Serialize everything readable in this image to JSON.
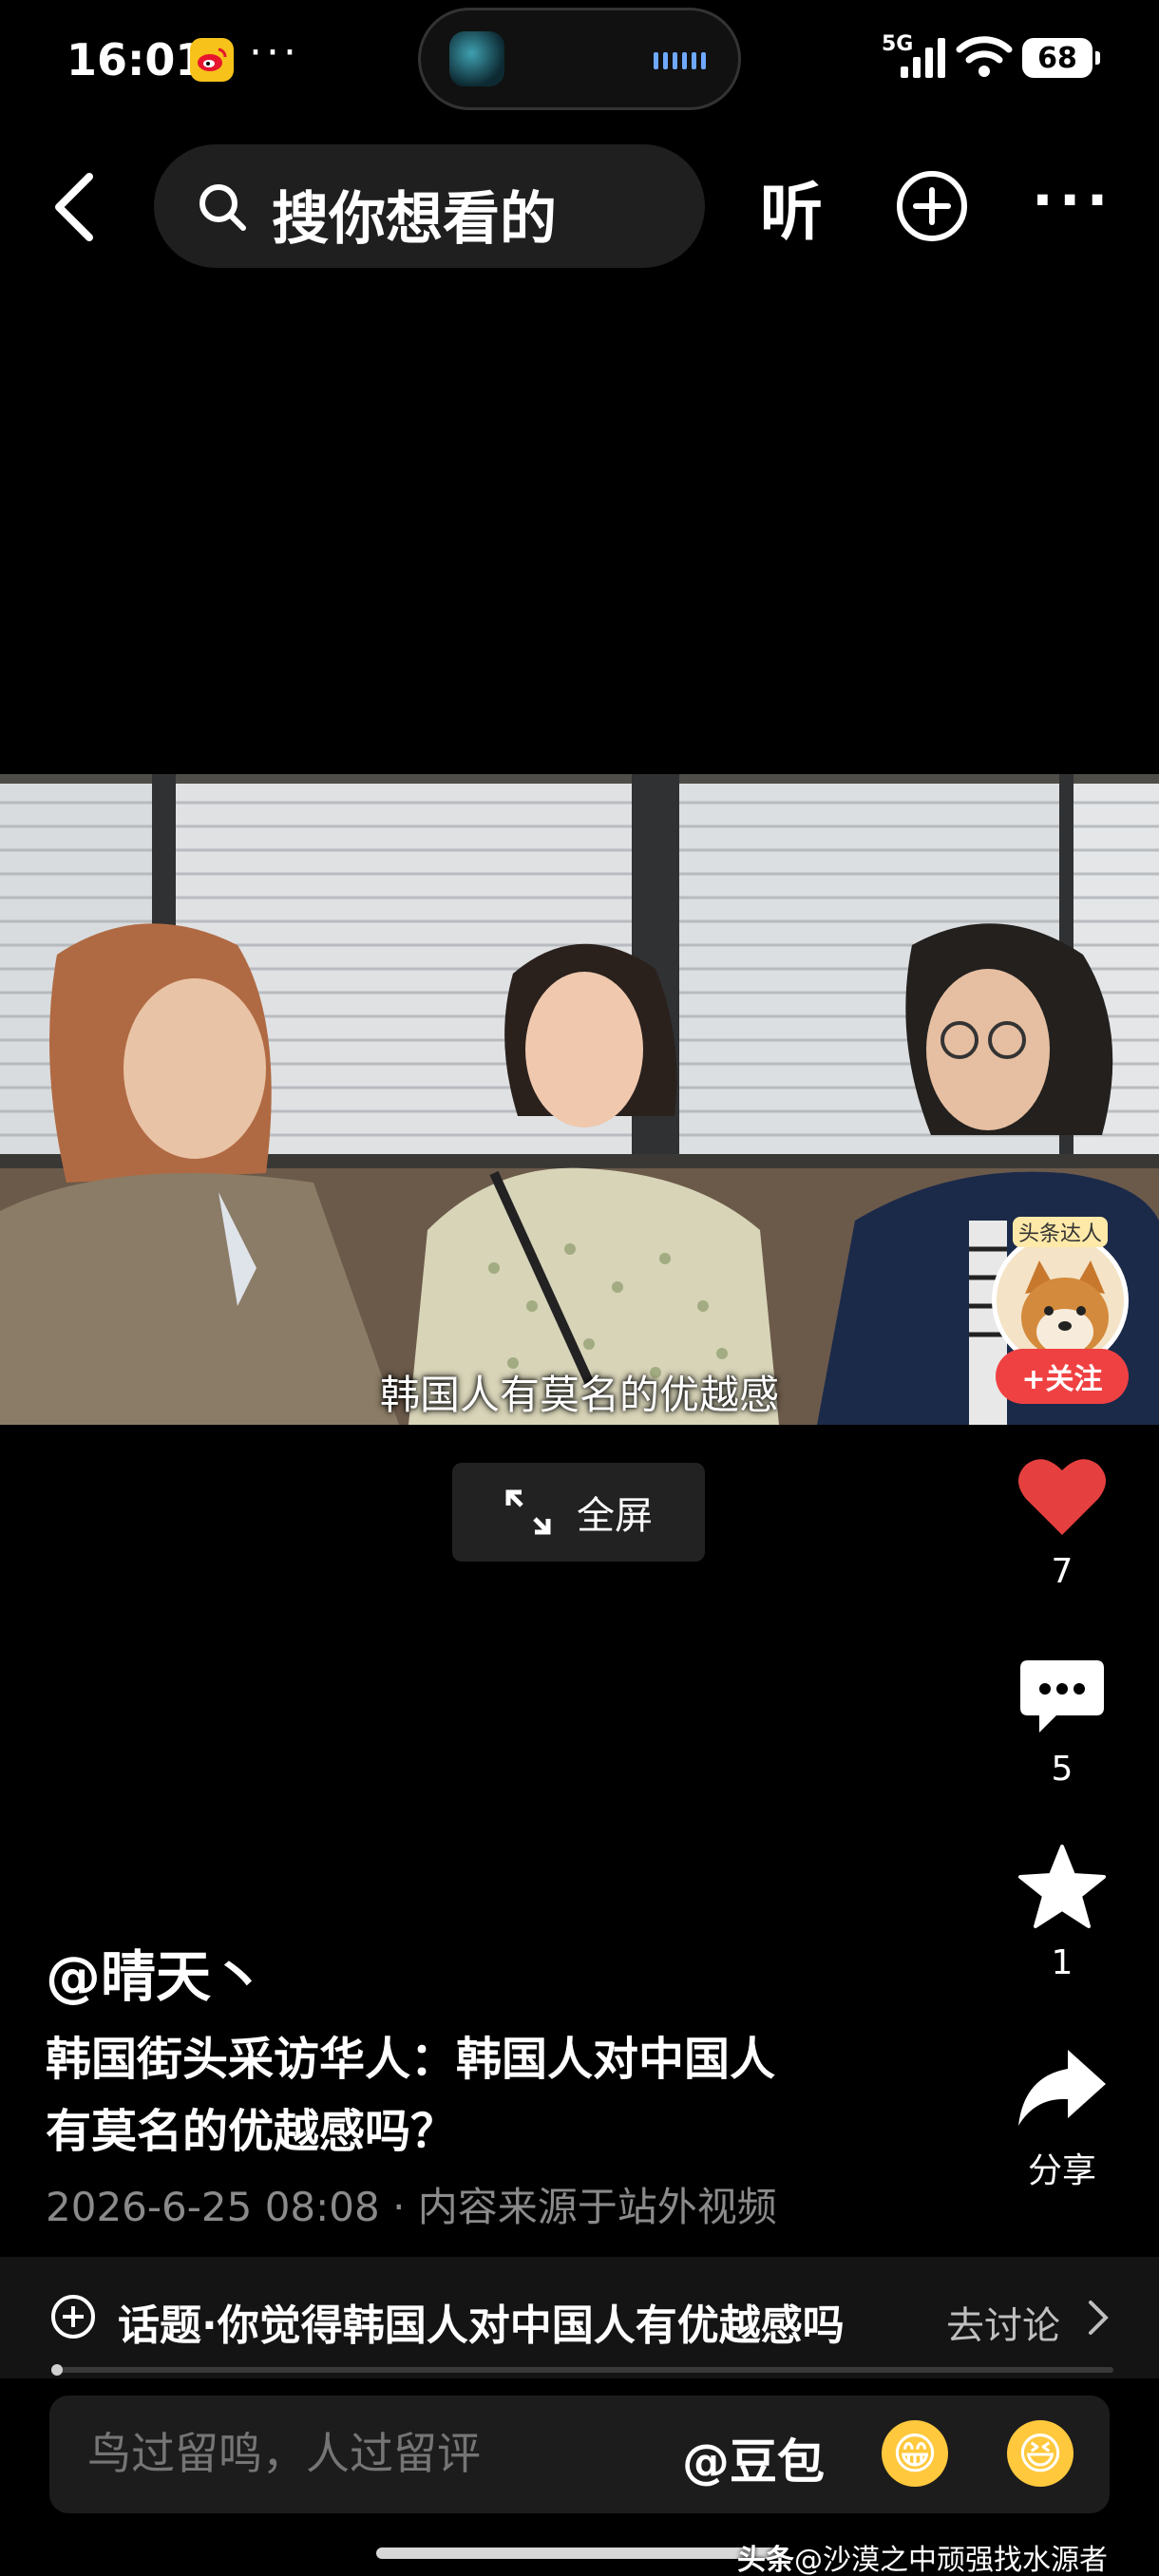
{
  "status_bar": {
    "time": "16:01",
    "dots": "···",
    "network": "5G",
    "battery": "68"
  },
  "nav": {
    "search_placeholder": "搜你想看的",
    "listen_label": "听",
    "more_label": "···"
  },
  "video": {
    "subtitle": "韩国人有莫名的优越感",
    "badge_text": "头条达人",
    "follow_label": "+关注",
    "fullscreen_label": "全屏"
  },
  "actions": {
    "like_count": "7",
    "comment_count": "5",
    "favorite_count": "1",
    "share_label": "分享",
    "like_color": "#e5403f"
  },
  "post": {
    "author": "@晴天丶",
    "title_line1": "韩国街头采访华人：韩国人对中国人",
    "title_line2": "有莫名的优越感吗？",
    "meta": "2026-6-25 08:08 · 内容来源于站外视频"
  },
  "topic": {
    "text": "话题·你觉得韩国人对中国人有优越感吗",
    "link": "去讨论"
  },
  "comment": {
    "placeholder": "鸟过留鸣，人过留评",
    "doubao_label": "@豆包",
    "emoji1": "😁",
    "emoji2": "😆"
  },
  "watermark": {
    "brand": "头条",
    "handle": "@沙漠之中顽强找水源者"
  }
}
